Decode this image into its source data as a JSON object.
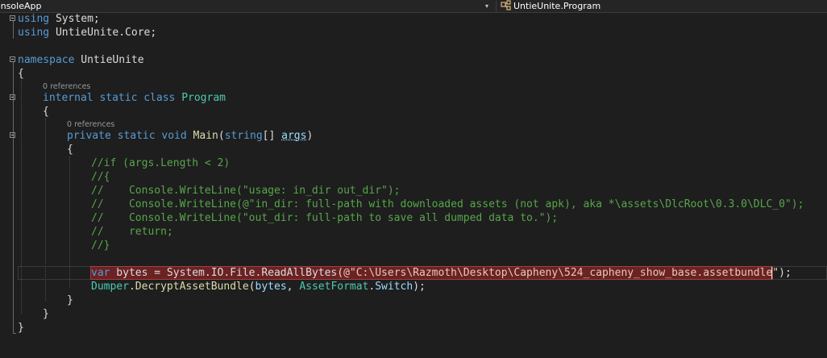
{
  "navbar": {
    "project": "onsoleApp",
    "dropdown_glyph": "▾",
    "class_icon": "class-icon",
    "current_member": "UntieUnite.Program"
  },
  "colors": {
    "background": "#1e1e1e",
    "keyword": "#569cd6",
    "type": "#4ec9b0",
    "method": "#dcdcaa",
    "parameter": "#9cdcfe",
    "comment": "#57a64a",
    "string": "#d69d85",
    "highlight": "#6b2222"
  },
  "code": {
    "using1": {
      "kw": "using",
      "ns": " System;"
    },
    "using2": {
      "kw": "using",
      "ns": " UntieUnite.Core;"
    },
    "ns_decl": {
      "kw": "namespace",
      "name": " UntieUnite"
    },
    "open_ns": "{",
    "lens_class": "0 references",
    "class_decl": {
      "kw": "internal static class ",
      "name": "Program"
    },
    "open_class": "{",
    "lens_main": "0 references",
    "main_decl": {
      "kw": "private static void ",
      "name": "Main",
      "open": "(",
      "type": "string",
      "brackets": "[] ",
      "param": "args",
      "close": ")"
    },
    "open_main": "{",
    "comments": [
      "//if (args.Length < 2)",
      "//{",
      "//    Console.WriteLine(\"usage: in_dir out_dir\");",
      "//    Console.WriteLine(@\"in_dir: full-path with downloaded assets (not apk), aka *\\assets\\DlcRoot\\0.3.0\\DLC_0\");",
      "//    Console.WriteLine(\"out_dir: full-path to save all dumped data to.\");",
      "//    return;",
      "//}"
    ],
    "bytes_line": {
      "kw": "var",
      "rest": " bytes = System.IO.File.ReadAllBytes(",
      "string": "@\"C:\\Users\\Razmoth\\Desktop\\Capheny\\524_capheny_show_base.assetbundle\"",
      "end": ");"
    },
    "dumper_line": {
      "type": "Dumper",
      "dot": ".",
      "method": "DecryptAssetBundle",
      "open": "(",
      "arg1": "bytes",
      "comma": ", ",
      "enum_type": "AssetFormat",
      "dot2": ".",
      "member": "Switch",
      "end": ");"
    },
    "close_main": "}",
    "close_class": "}",
    "close_ns": "}"
  }
}
